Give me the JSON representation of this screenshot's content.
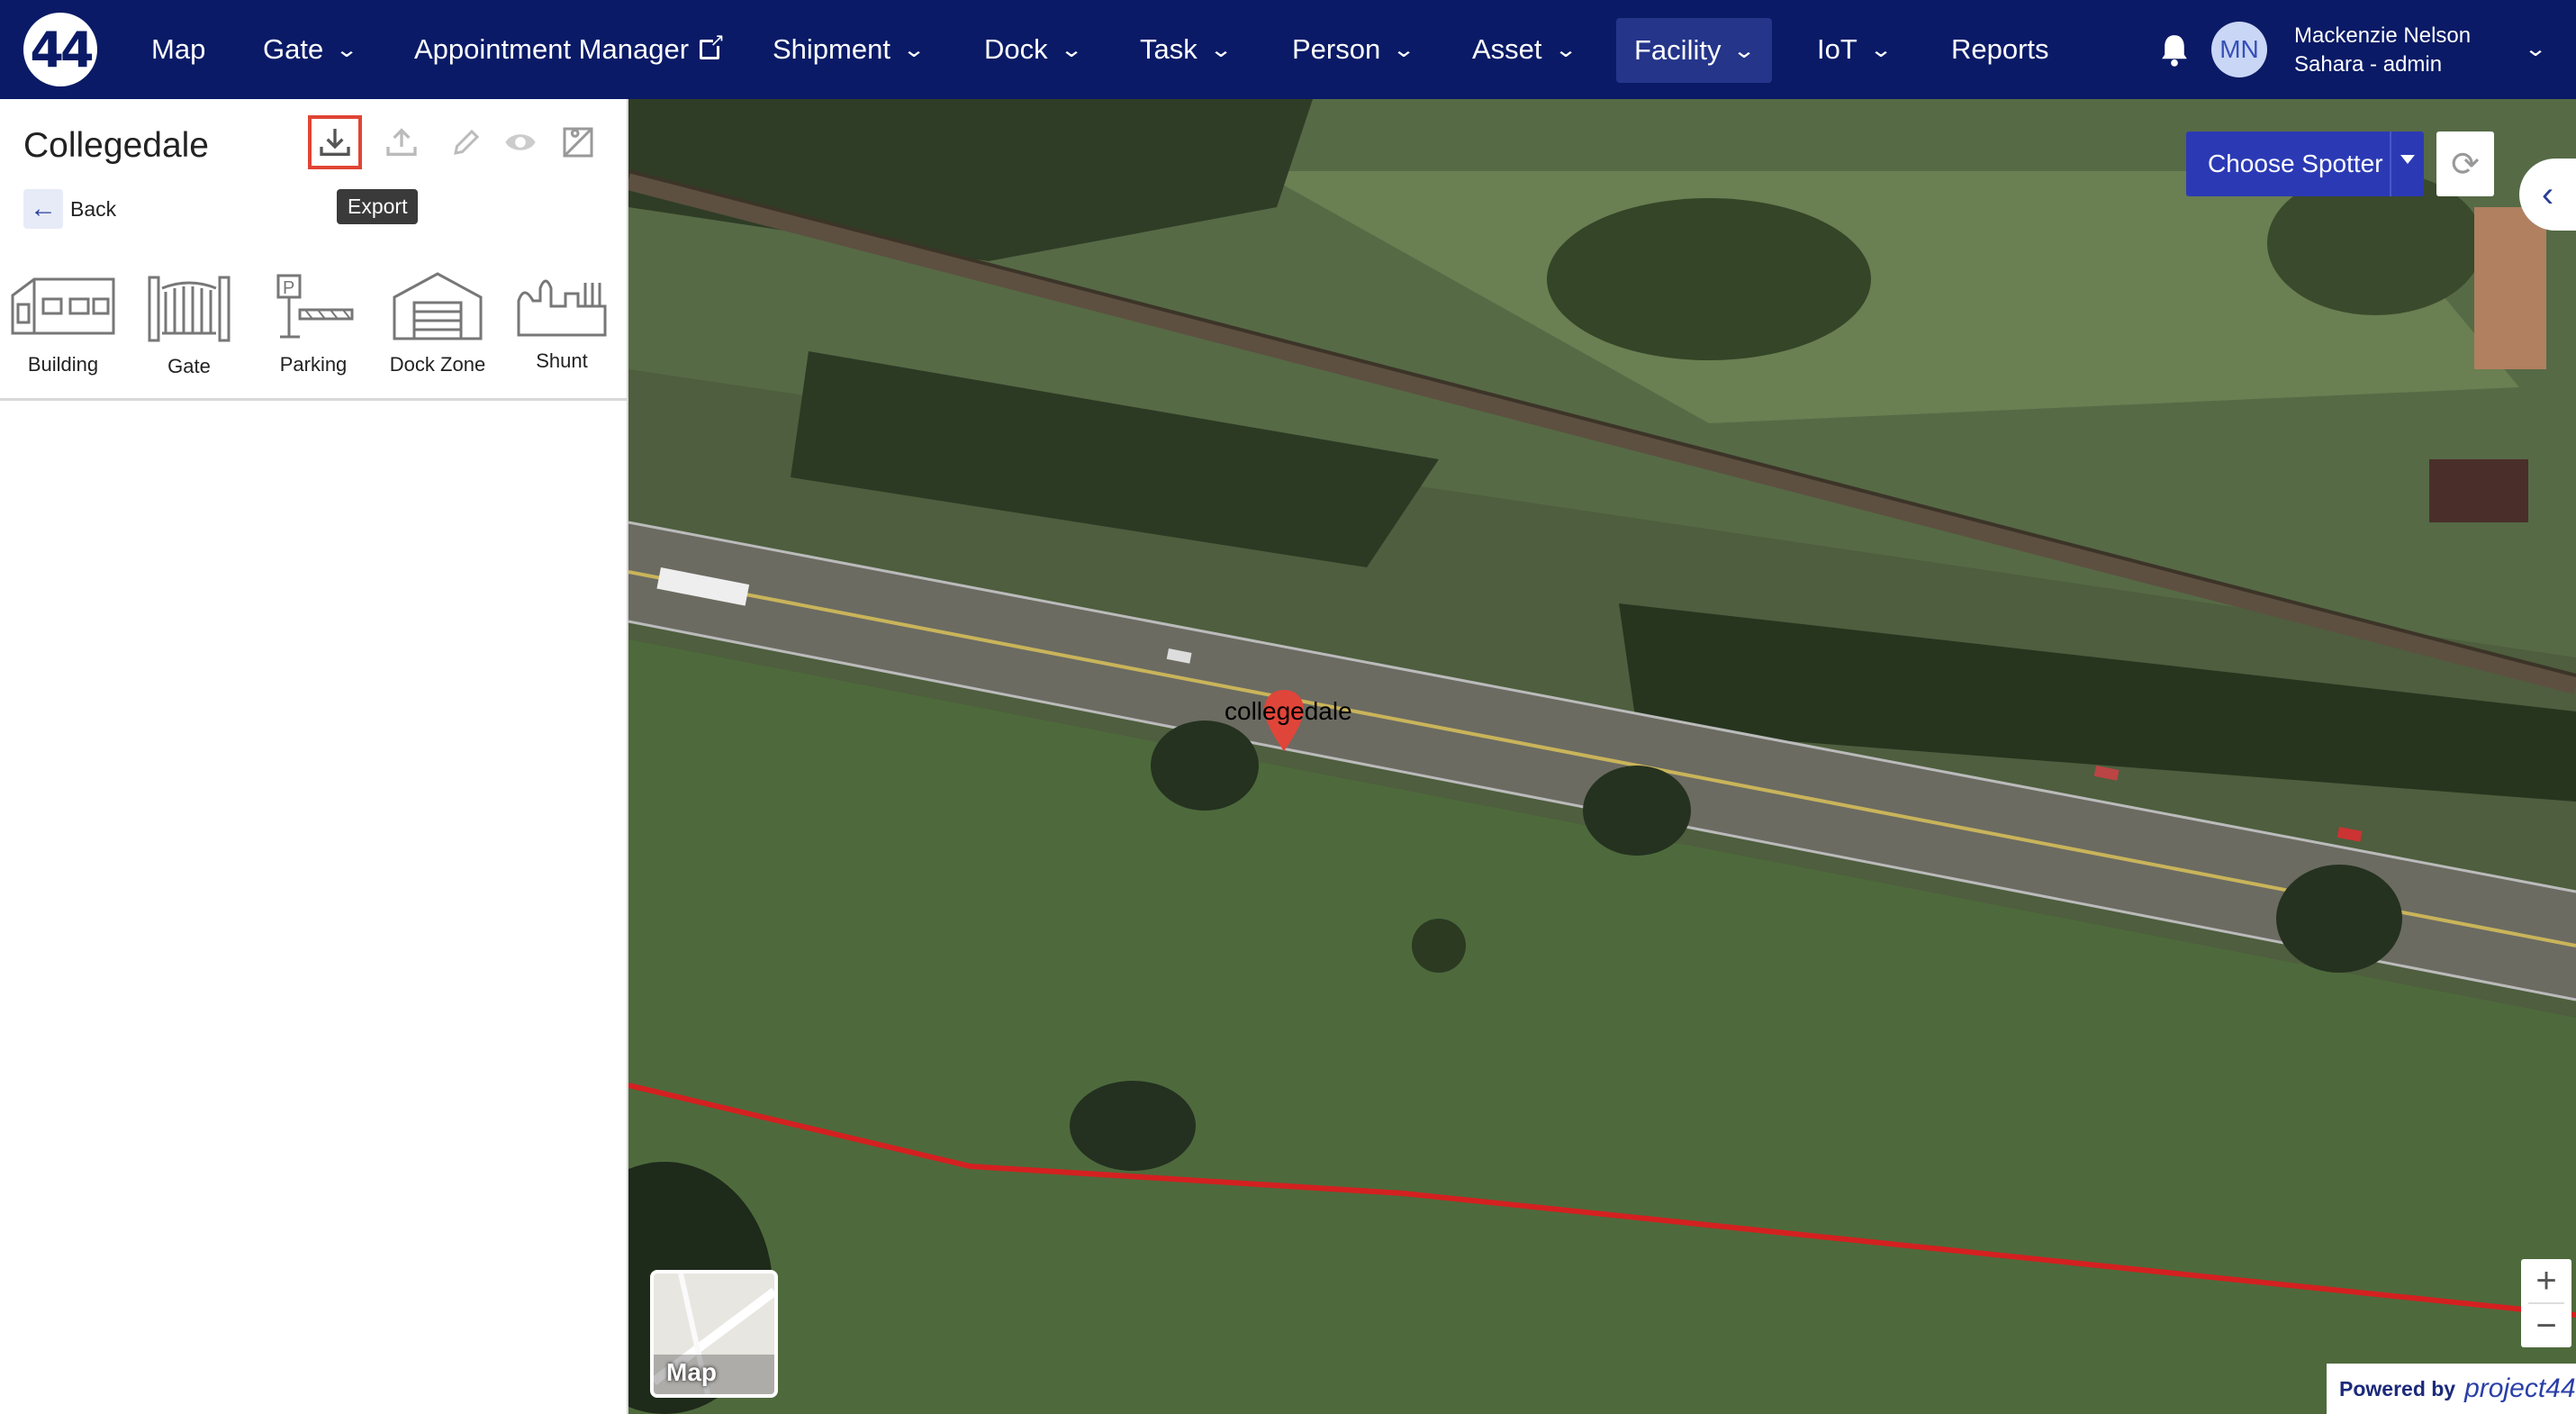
{
  "nav": {
    "logo_text": "44",
    "items": [
      {
        "label": "Map",
        "has_dropdown": false
      },
      {
        "label": "Gate",
        "has_dropdown": true
      },
      {
        "label": "Appointment Manager",
        "has_dropdown": false,
        "external": true
      },
      {
        "label": "Shipment",
        "has_dropdown": true
      },
      {
        "label": "Dock",
        "has_dropdown": true
      },
      {
        "label": "Task",
        "has_dropdown": true
      },
      {
        "label": "Person",
        "has_dropdown": true
      },
      {
        "label": "Asset",
        "has_dropdown": true
      },
      {
        "label": "Facility",
        "has_dropdown": true,
        "active": true
      },
      {
        "label": "IoT",
        "has_dropdown": true
      },
      {
        "label": "Reports",
        "has_dropdown": false
      }
    ],
    "user": {
      "initials": "MN",
      "name": "Mackenzie Nelson",
      "role": "Sahara - admin"
    }
  },
  "panel": {
    "title": "Collegedale",
    "back_label": "Back",
    "tooltip": "Export",
    "tools": [
      "export-icon",
      "import-icon",
      "edit-icon",
      "view-icon",
      "map-image-icon"
    ],
    "shapes": [
      {
        "label": "Building",
        "icon": "building-icon"
      },
      {
        "label": "Gate",
        "icon": "gate-icon"
      },
      {
        "label": "Parking",
        "icon": "parking-icon"
      },
      {
        "label": "Dock Zone",
        "icon": "dock-zone-icon"
      },
      {
        "label": "Shunt",
        "icon": "shunt-icon"
      }
    ]
  },
  "map": {
    "spotter_label": "Choose Spotter",
    "pin_label": "collegedale",
    "map_type_label": "Map",
    "zoom_in": "+",
    "zoom_out": "−",
    "powered_by": "Powered by",
    "brand": "project44",
    "boundary_color": "#d42020",
    "marker_color": "#e0453a"
  },
  "colors": {
    "nav_bg": "#0a1a66",
    "accent": "#2b3ab4",
    "highlight": "#e04434"
  }
}
